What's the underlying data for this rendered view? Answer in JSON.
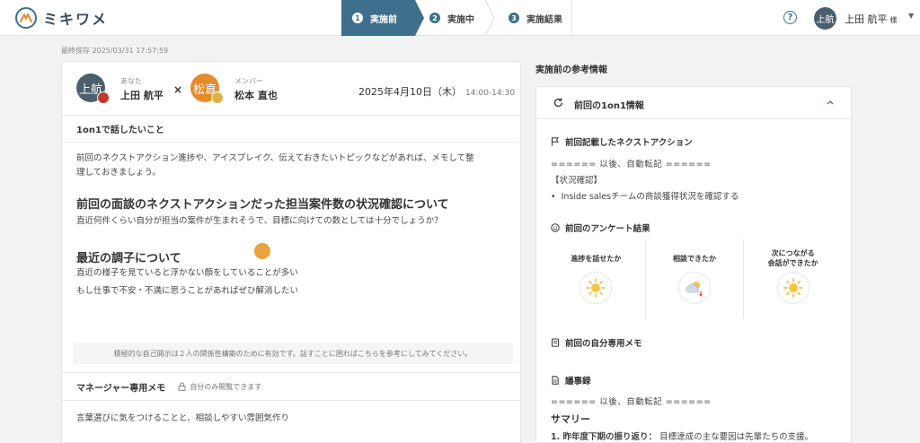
{
  "header": {
    "logo_text": "ミキワメ",
    "steps": [
      {
        "num": "1",
        "label": "実施前"
      },
      {
        "num": "2",
        "label": "実施中"
      },
      {
        "num": "3",
        "label": "実施結果"
      }
    ],
    "help": "?",
    "user": {
      "avatar": "上航",
      "name": "上田 航平",
      "suffix": "様"
    }
  },
  "saved": "最終保存 2025/03/31 17:57:59",
  "meeting": {
    "me": {
      "role": "あなた",
      "name": "上田 航平",
      "avatar": "上航"
    },
    "cross": "×",
    "member": {
      "role": "メンバー",
      "name": "松本 直也",
      "avatar": "松直"
    },
    "date": "2025年4月10日（木）",
    "time": "14:00-14:30"
  },
  "talk": {
    "title": "1on1で話したいこと",
    "intro_1": "前回のネクストアクション進捗や、アイスブレイク、伝えておきたいトピックなどがあれば、メモして整",
    "intro_2": "理しておきましょう。",
    "heading_1": "前回の面談のネクストアクションだった担当案件数の状況確認について",
    "para_1": "直近何件くらい自分が担当の案件が生まれそうで、目標に向けての数としては十分でしょうか？",
    "heading_2": "最近の調子について",
    "para_2": "直近の様子を見ていると浮かない顔をしていることが多い",
    "para_3": "もし仕事で不安・不満に思うことがあればぜひ解消したい",
    "hint": "積極的な自己開示は２人の関係性構築のために有効です。話すことに困ればこちらを参考にしてみてください。"
  },
  "manager_memo": {
    "title": "マネージャー専用メモ",
    "note": "自分のみ閲覧できます",
    "text": "言葉選びに気をつけることと、相談しやすい雰囲気作り"
  },
  "reference": {
    "title": "実施前の参考情報",
    "panel_title": "前回の1on1情報",
    "next_action_title": "前回記載したネクストアクション",
    "next_action_line": "====== 以後、自動転記 ======",
    "next_action_tag": "【状況確認】",
    "next_action_item": "Inside salesチームの商談獲得状況を確認する",
    "survey_title": "前回のアンケート結果",
    "survey": [
      {
        "label_1": "進捗を話せたか",
        "label_2": "",
        "icon": "sun-icon"
      },
      {
        "label_1": "相談できたか",
        "label_2": "",
        "icon": "cloudy-rain-icon"
      },
      {
        "label_1": "次につながる",
        "label_2": "会話ができたか",
        "icon": "sun-icon"
      }
    ],
    "self_memo_title": "前回の自分専用メモ",
    "minutes_title": "議事録",
    "minutes_line": "====== 以後、自動転記 ======",
    "summary": "サマリー",
    "summary_item_label": "1. 昨年度下期の振り返り：",
    "summary_item_text": "目標達成の主な要因は先輩たちの支援。"
  }
}
